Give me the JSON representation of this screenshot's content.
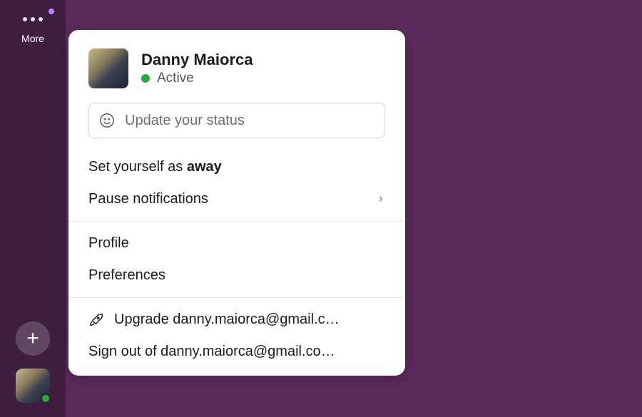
{
  "sidebar": {
    "more_label": "More"
  },
  "user": {
    "name": "Danny Maiorca",
    "presence": "Active"
  },
  "status_input": {
    "placeholder": "Update your status"
  },
  "menu": {
    "set_away_prefix": "Set yourself as ",
    "set_away_bold": "away",
    "pause_notifications": "Pause notifications",
    "profile": "Profile",
    "preferences": "Preferences",
    "upgrade": "Upgrade danny.maiorca@gmail.c…",
    "signout": "Sign out of danny.maiorca@gmail.co…"
  }
}
